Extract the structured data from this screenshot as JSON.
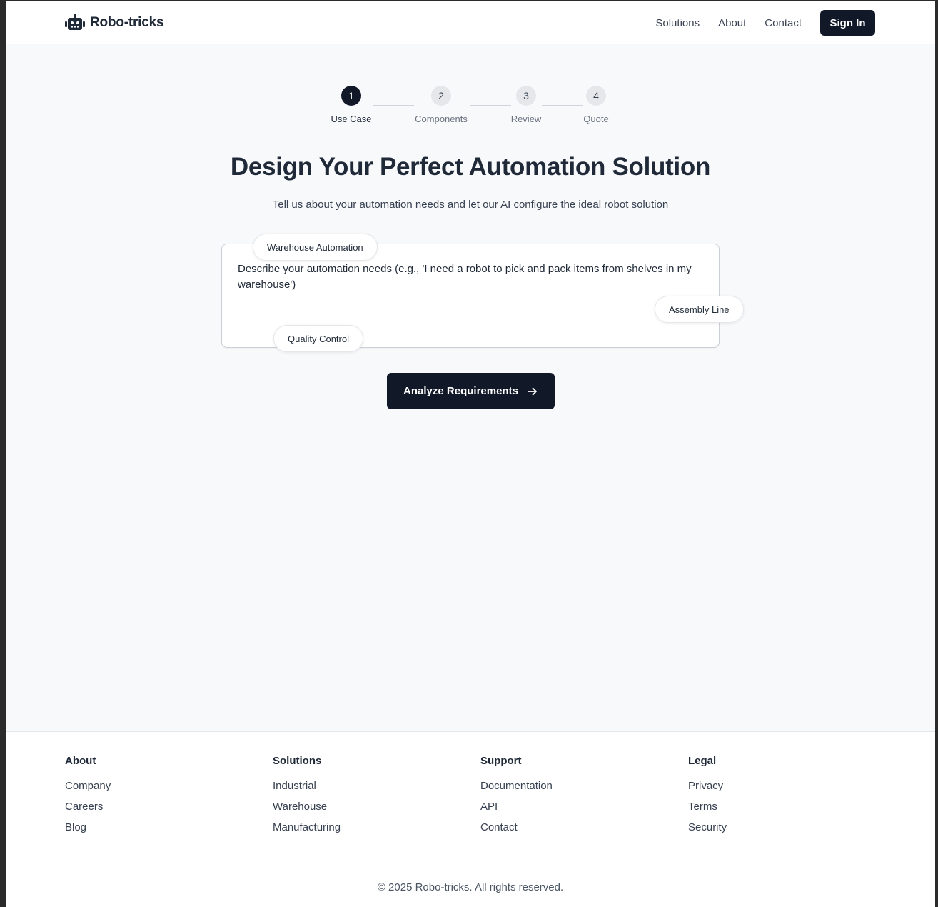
{
  "header": {
    "brand": "Robo-tricks",
    "nav": [
      "Solutions",
      "About",
      "Contact"
    ],
    "sign_in": "Sign In"
  },
  "stepper": {
    "current": 1,
    "steps": [
      {
        "number": "1",
        "label": "Use Case"
      },
      {
        "number": "2",
        "label": "Components"
      },
      {
        "number": "3",
        "label": "Review"
      },
      {
        "number": "4",
        "label": "Quote"
      }
    ]
  },
  "hero": {
    "title": "Design Your Perfect Automation Solution",
    "subtitle": "Tell us about your automation needs and let our AI configure the ideal robot solution"
  },
  "needs_input": {
    "value": "",
    "placeholder": "Describe your automation needs (e.g., 'I need a robot to pick and pack items from shelves in my warehouse')"
  },
  "suggestions": [
    "Warehouse Automation",
    "Assembly Line",
    "Quality Control"
  ],
  "analyze_button": {
    "label": "Analyze Requirements",
    "icon": "arrow-right-icon"
  },
  "footer": {
    "columns": [
      {
        "title": "About",
        "links": [
          "Company",
          "Careers",
          "Blog"
        ]
      },
      {
        "title": "Solutions",
        "links": [
          "Industrial",
          "Warehouse",
          "Manufacturing"
        ]
      },
      {
        "title": "Support",
        "links": [
          "Documentation",
          "API",
          "Contact"
        ]
      },
      {
        "title": "Legal",
        "links": [
          "Privacy",
          "Terms",
          "Security"
        ]
      }
    ],
    "copyright": "© 2025 Robo-tricks. All rights reserved."
  },
  "colors": {
    "primary": "#111827",
    "background": "#f8f9fb",
    "muted_text": "#6b7280",
    "step_inactive": "#e5e7eb"
  }
}
